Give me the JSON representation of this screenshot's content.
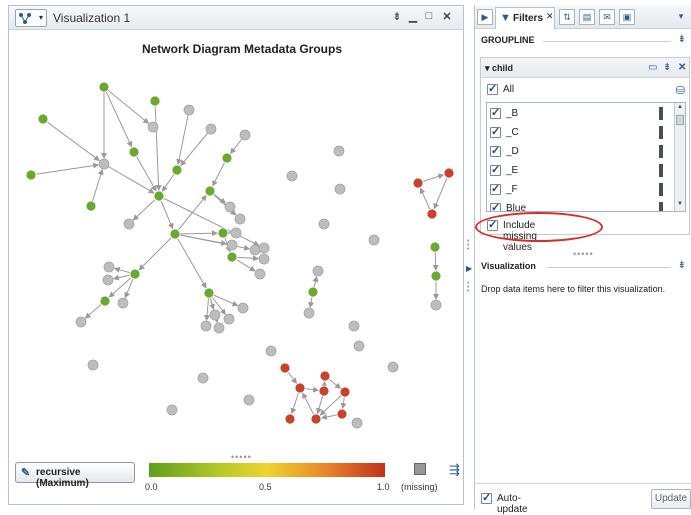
{
  "viz": {
    "title": "Visualization 1",
    "chart_title": "Network Diagram Metadata Groups",
    "recursive_button": "recursive (Maximum)",
    "legend_ticks": [
      "0.0",
      "0.5",
      "1.0"
    ],
    "missing_label": "(missing)",
    "colors": {
      "green": "#6aa830",
      "gray": "#bdbdbd",
      "red": "#c8432c",
      "link": "#9a9a9a"
    }
  },
  "right": {
    "tab_filters": "Filters",
    "groupline_title": "GROUPLINE",
    "child_title": "child",
    "all_label": "All",
    "items": [
      "_B",
      "_C",
      "_D",
      "_E",
      "_F",
      "Blue"
    ],
    "missing_label": "Include missing values",
    "viz_section_title": "Visualization",
    "drop_text": "Drop data items here to filter this visualization.",
    "auto_update": "Auto-update",
    "update_button": "Update"
  }
}
